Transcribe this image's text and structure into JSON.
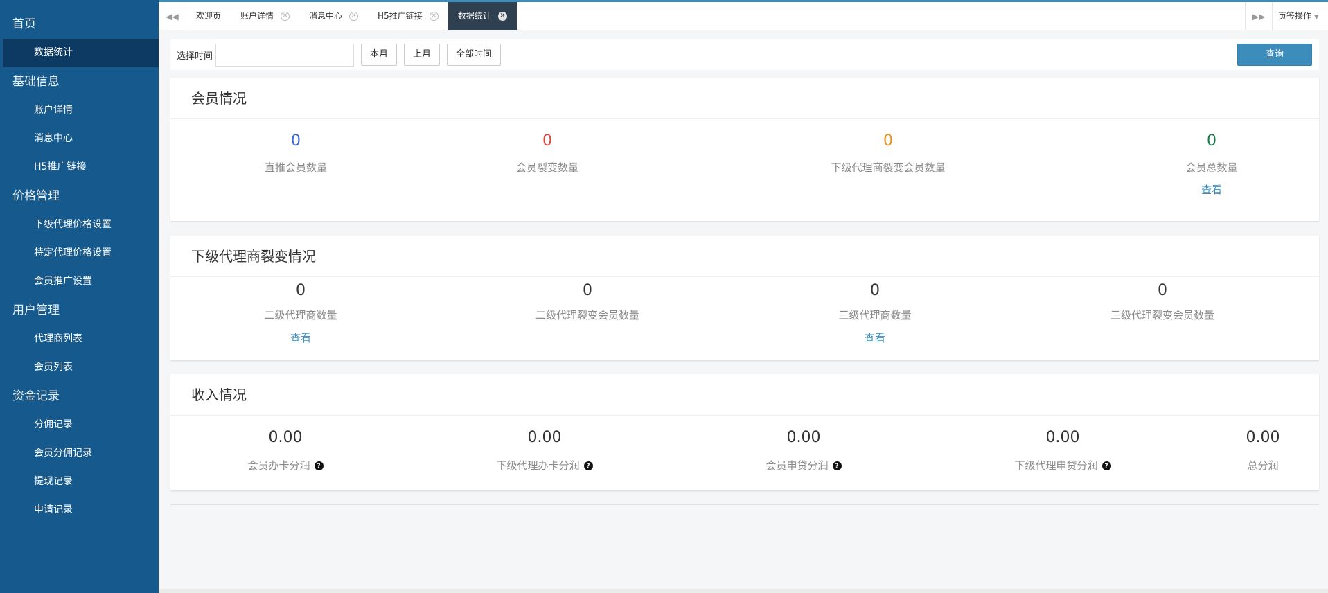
{
  "sidebar": {
    "groups": [
      {
        "label": "首页",
        "items": [
          "数据统计"
        ]
      },
      {
        "label": "基础信息",
        "items": [
          "账户详情",
          "消息中心",
          "H5推广链接"
        ]
      },
      {
        "label": "价格管理",
        "items": [
          "下级代理价格设置",
          "特定代理价格设置",
          "会员推广设置"
        ]
      },
      {
        "label": "用户管理",
        "items": [
          "代理商列表",
          "会员列表"
        ]
      },
      {
        "label": "资金记录",
        "items": [
          "分佣记录",
          "会员分佣记录",
          "提现记录",
          "申请记录"
        ]
      }
    ]
  },
  "tabbar": {
    "tabs": [
      "欢迎页",
      "账户详情",
      "消息中心",
      "H5推广链接",
      "数据统计"
    ],
    "ops_label": "页签操作"
  },
  "filter": {
    "label": "选择时间",
    "input_value": "",
    "btn_this_month": "本月",
    "btn_last_month": "上月",
    "btn_all_time": "全部时间",
    "query_label": "查询"
  },
  "members": {
    "title": "会员情况",
    "stats": [
      {
        "value": "0",
        "label": "直推会员数量",
        "color": "#3a66d6"
      },
      {
        "value": "0",
        "label": "会员裂变数量",
        "color": "#e0463c"
      },
      {
        "value": "0",
        "label": "下级代理商裂变会员数量",
        "color": "#f0901c"
      },
      {
        "value": "0",
        "label": "会员总数量",
        "color": "#1d7a4a",
        "link": "查看"
      }
    ]
  },
  "agents": {
    "title": "下级代理商裂变情况",
    "stats": [
      {
        "value": "0",
        "label": "二级代理商数量",
        "link": "查看"
      },
      {
        "value": "0",
        "label": "二级代理裂变会员数量"
      },
      {
        "value": "0",
        "label": "三级代理商数量",
        "link": "查看"
      },
      {
        "value": "0",
        "label": "三级代理裂变会员数量"
      }
    ]
  },
  "income": {
    "title": "收入情况",
    "stats": [
      {
        "value": "0.00",
        "label": "会员办卡分润"
      },
      {
        "value": "0.00",
        "label": "下级代理办卡分润"
      },
      {
        "value": "0.00",
        "label": "会员申贷分润"
      },
      {
        "value": "0.00",
        "label": "下级代理申贷分润"
      },
      {
        "value": "0.00",
        "label": "总分润"
      }
    ]
  }
}
